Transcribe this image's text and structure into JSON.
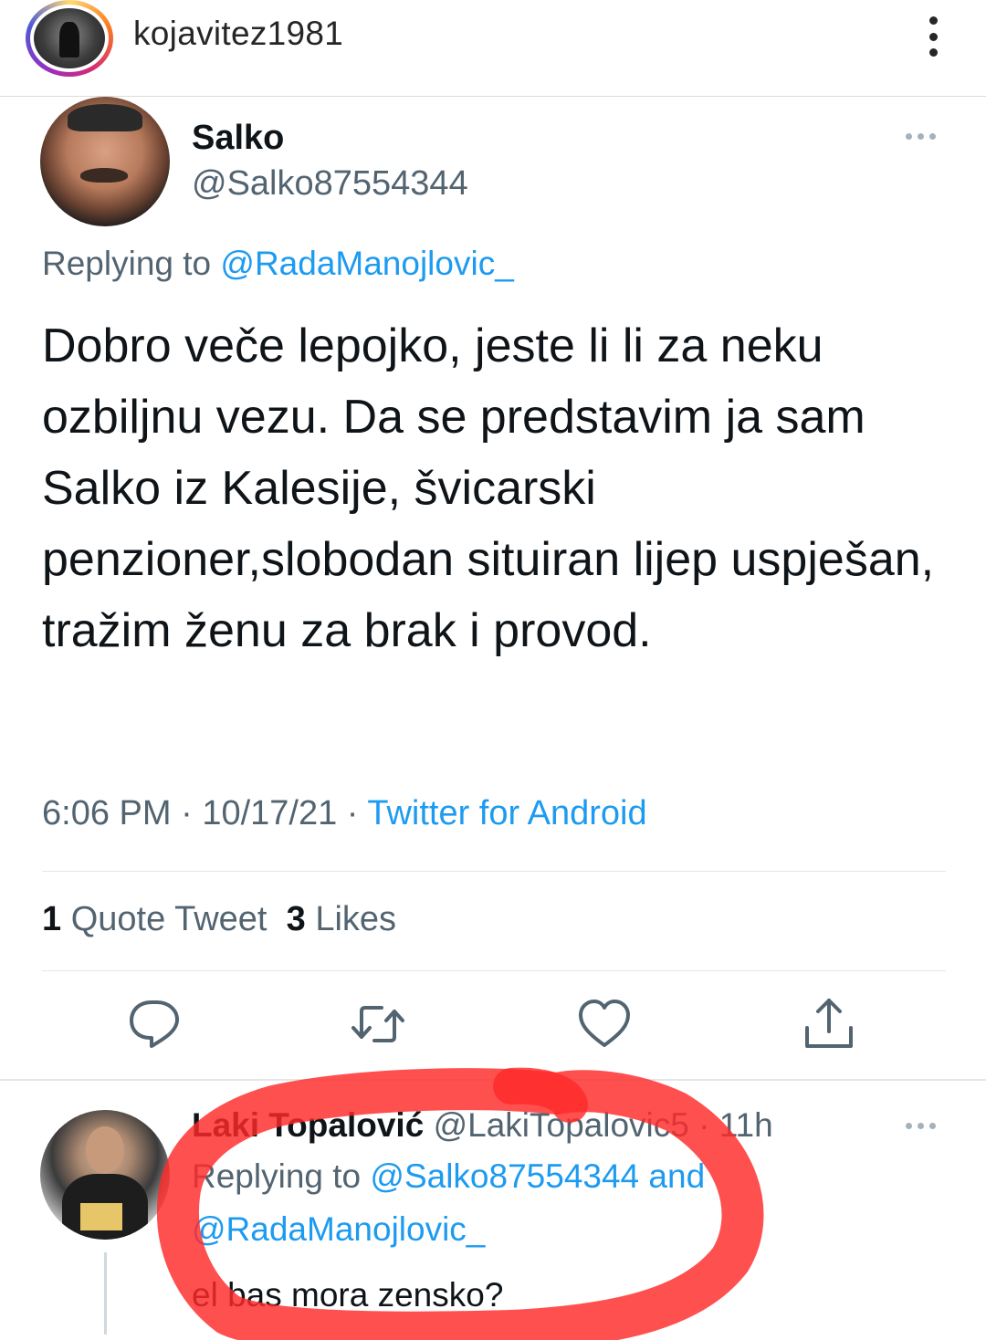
{
  "instagram": {
    "username": "kojavitez1981"
  },
  "tweet": {
    "author_name": "Salko",
    "author_handle": "@Salko87554344",
    "replying_prefix": "Replying to ",
    "replying_to": "@RadaManojlovic_",
    "text": "Dobro veče lepojko, jeste li li za neku ozbiljnu vezu. Da se predstavim ja sam Salko iz Kalesije, švicarski penzioner,slobodan situiran lijep uspješan, tražim ženu za brak i provod.",
    "time": "6:06 PM",
    "date": "10/17/21",
    "source": "Twitter for Android",
    "quote_count": "1",
    "quote_label": "Quote Tweet",
    "likes_count": "3",
    "likes_label": "Likes"
  },
  "reply": {
    "author_name": "Laki Topalović",
    "author_handle": "@LakiTopalovic5",
    "age": "11h",
    "replying_prefix": "Replying to ",
    "replying_to_1": "@Salko87554344",
    "replying_and": " and",
    "replying_to_2": "@RadaManojlovic_",
    "text": "el bas mora zensko?"
  },
  "colors": {
    "link": "#1d9bf0",
    "secondary_text": "#536471",
    "annotation": "#ff2a2a"
  },
  "icons": [
    "more-vertical-icon",
    "more-horizontal-icon",
    "reply-icon",
    "retweet-icon",
    "like-icon",
    "share-icon"
  ]
}
